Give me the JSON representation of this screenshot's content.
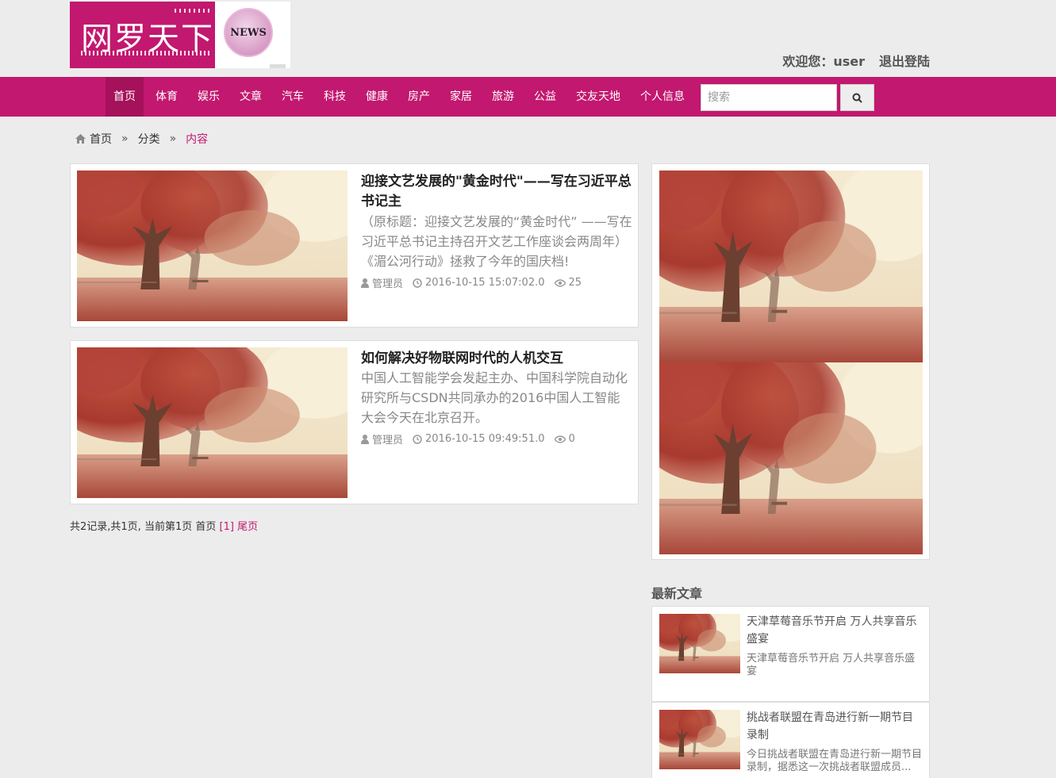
{
  "header": {
    "logo_text": "网罗天下",
    "logo_badge": "NEWS",
    "welcome": "欢迎您：user",
    "logout": "退出登陆"
  },
  "nav": {
    "items": [
      "首页",
      "体育",
      "娱乐",
      "文章",
      "汽车",
      "科技",
      "健康",
      "房产",
      "家居",
      "旅游",
      "公益",
      "交友天地",
      "个人信息"
    ],
    "search_placeholder": "搜索"
  },
  "breadcrumb": {
    "home": "首页",
    "sep": "»",
    "category": "分类",
    "current": "内容"
  },
  "articles": [
    {
      "title": "迎接文艺发展的\"黄金时代\"——写在习近平总书记主",
      "summary": "（原标题：迎接文艺发展的“黄金时代” ——写在习近平总书记主持召开文艺工作座谈会两周年）《湄公河行动》拯救了今年的国庆档!",
      "author": "管理员",
      "time": "2016-10-15 15:07:02.0",
      "views": "25"
    },
    {
      "title": "如何解决好物联网时代的人机交互",
      "summary": "中国人工智能学会发起主办、中国科学院自动化研究所与CSDN共同承办的2016中国人工智能大会今天在北京召开。",
      "author": "管理员",
      "time": "2016-10-15 09:49:51.0",
      "views": "0"
    }
  ],
  "pager": {
    "summary": "共2记录,共1页, 当前第1页",
    "first": "首页",
    "current": "[1]",
    "last": "尾页"
  },
  "sidebar": {
    "latest_title": "最新文章",
    "latest": [
      {
        "title": "天津草莓音乐节开启 万人共享音乐盛宴",
        "desc": "天津草莓音乐节开启 万人共享音乐盛宴"
      },
      {
        "title": "挑战者联盟在青岛进行新一期节目录制",
        "desc": "今日挑战者联盟在青岛进行新一期节目录制，据悉这一次挑战者联盟成员..."
      }
    ]
  },
  "colors": {
    "brand": "#c2186f",
    "nav_active": "#a5115b",
    "background": "#ececec"
  }
}
